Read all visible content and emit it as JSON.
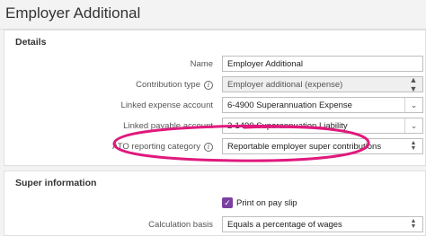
{
  "page": {
    "title": "Employer Additional"
  },
  "details": {
    "heading": "Details",
    "name": {
      "label": "Name",
      "value": "Employer Additional"
    },
    "contribution_type": {
      "label": "Contribution type",
      "value": "Employer additional (expense)"
    },
    "linked_expense": {
      "label": "Linked expense account",
      "value": "6-4900 Superannuation Expense"
    },
    "linked_payable": {
      "label": "Linked payable account",
      "value": "2-1490 Superannuation Liability"
    },
    "ato_category": {
      "label": "ATO reporting category",
      "value": "Reportable employer super contributions"
    }
  },
  "super_info": {
    "heading": "Super information",
    "print_on_pay_slip": {
      "label": "Print on pay slip",
      "checked": true
    },
    "calculation_basis": {
      "label": "Calculation basis",
      "value": "Equals a percentage of wages"
    }
  },
  "icons": {
    "info": "info-icon",
    "dropdown": "chevron-down-icon",
    "select": "up-down-arrows-icon",
    "check": "checkmark-icon"
  },
  "colors": {
    "checkbox": "#7b3fa0",
    "highlight": "#e0197d"
  }
}
